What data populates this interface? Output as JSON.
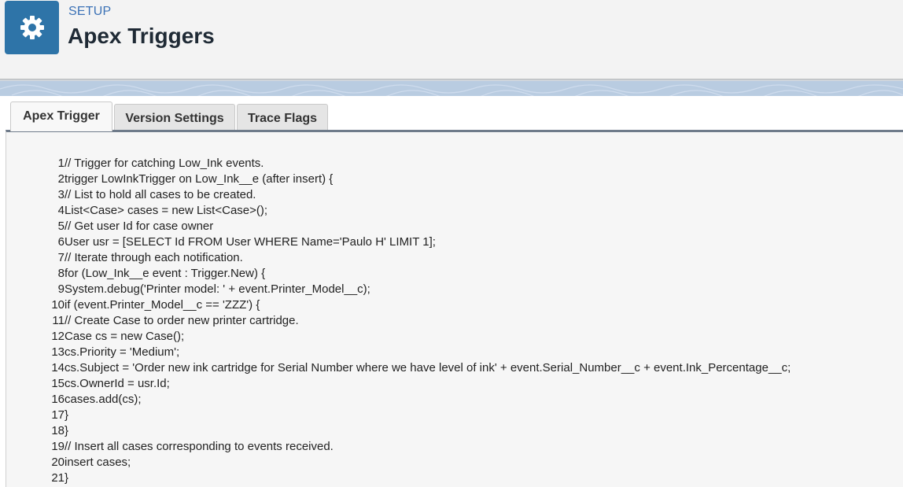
{
  "header": {
    "breadcrumb": "SETUP",
    "title": "Apex Triggers",
    "icon": "gear-icon"
  },
  "tabs": [
    {
      "label": "Apex Trigger",
      "active": true
    },
    {
      "label": "Version Settings",
      "active": false
    },
    {
      "label": "Trace Flags",
      "active": false
    }
  ],
  "colors": {
    "brand": "#2e74a8",
    "breadcrumb": "#3c72b6",
    "title": "#1f2a35"
  },
  "code": {
    "lines": [
      {
        "num": "1",
        "text": "// Trigger for catching Low_Ink events."
      },
      {
        "num": "2",
        "text": "trigger LowInkTrigger on Low_Ink__e (after insert) {"
      },
      {
        "num": "3",
        "text": "// List to hold all cases to be created."
      },
      {
        "num": "4",
        "text": "List<Case> cases = new List<Case>();"
      },
      {
        "num": "5",
        "text": "// Get user Id for case owner"
      },
      {
        "num": "6",
        "text": "User usr = [SELECT Id FROM User WHERE Name='Paulo H' LIMIT 1];"
      },
      {
        "num": "7",
        "text": "// Iterate through each notification."
      },
      {
        "num": "8",
        "text": "for (Low_Ink__e event : Trigger.New) {"
      },
      {
        "num": "9",
        "text": "System.debug('Printer model: ' + event.Printer_Model__c);"
      },
      {
        "num": "10",
        "text": "if (event.Printer_Model__c == 'ZZZ') {"
      },
      {
        "num": "11",
        "text": "// Create Case to order new printer cartridge."
      },
      {
        "num": "12",
        "text": "Case cs = new Case();"
      },
      {
        "num": "13",
        "text": "cs.Priority = 'Medium';"
      },
      {
        "num": "14",
        "text": "cs.Subject = 'Order new ink cartridge for Serial Number where we have level of ink' + event.Serial_Number__c + event.Ink_Percentage__c;"
      },
      {
        "num": "15",
        "text": "cs.OwnerId = usr.Id;"
      },
      {
        "num": "16",
        "text": "cases.add(cs);"
      },
      {
        "num": "17",
        "text": "}"
      },
      {
        "num": "18",
        "text": "}"
      },
      {
        "num": "19",
        "text": "// Insert all cases corresponding to events received."
      },
      {
        "num": "20",
        "text": "insert cases;"
      },
      {
        "num": "21",
        "text": "}"
      }
    ]
  }
}
